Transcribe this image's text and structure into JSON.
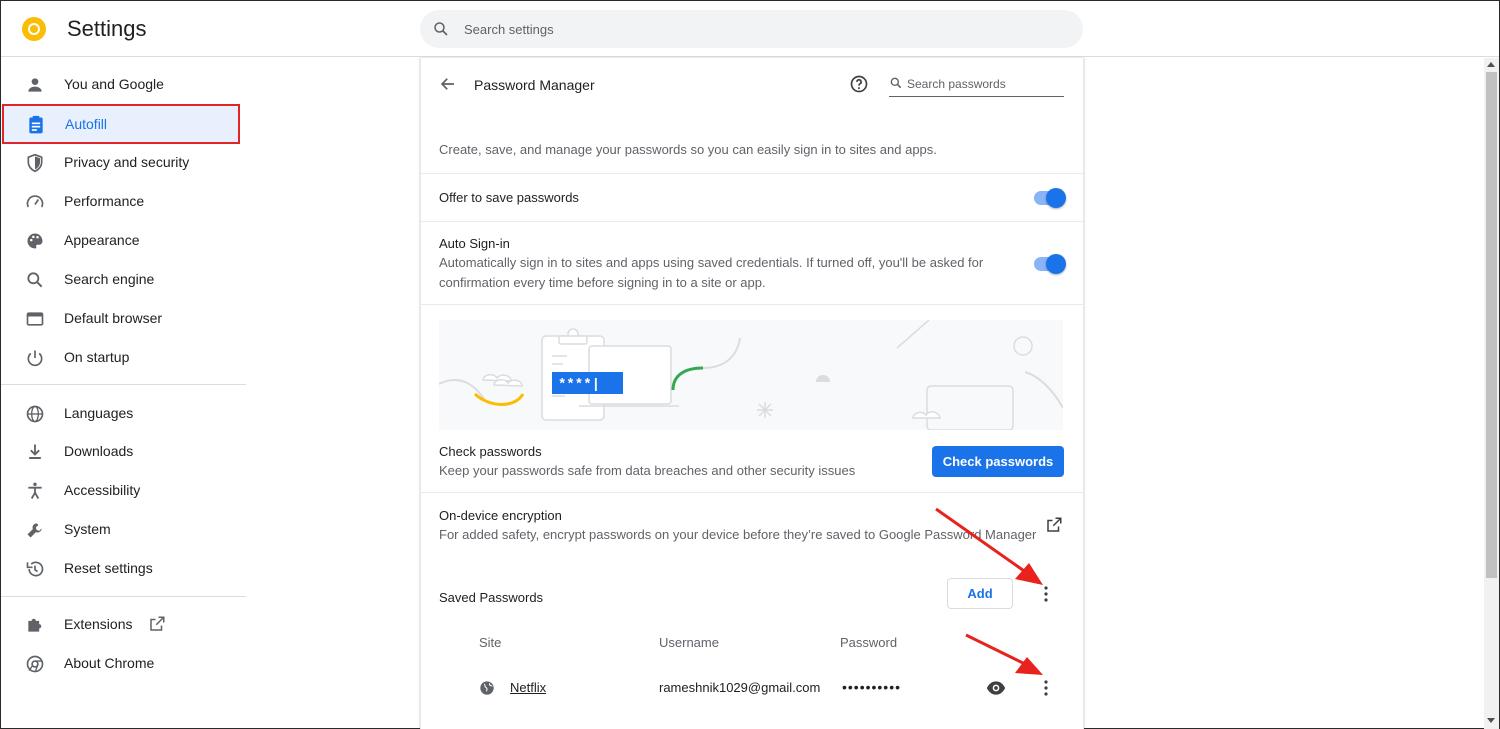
{
  "header": {
    "title": "Settings",
    "search_placeholder": "Search settings"
  },
  "sidebar": {
    "items": [
      {
        "label": "You and Google",
        "icon": "person-icon"
      },
      {
        "label": "Autofill",
        "icon": "clipboard-icon"
      },
      {
        "label": "Privacy and security",
        "icon": "shield-icon"
      },
      {
        "label": "Performance",
        "icon": "speedometer-icon"
      },
      {
        "label": "Appearance",
        "icon": "palette-icon"
      },
      {
        "label": "Search engine",
        "icon": "search-icon"
      },
      {
        "label": "Default browser",
        "icon": "browser-window-icon"
      },
      {
        "label": "On startup",
        "icon": "power-icon"
      },
      {
        "label": "Languages",
        "icon": "globe-icon"
      },
      {
        "label": "Downloads",
        "icon": "download-icon"
      },
      {
        "label": "Accessibility",
        "icon": "accessibility-icon"
      },
      {
        "label": "System",
        "icon": "wrench-icon"
      },
      {
        "label": "Reset settings",
        "icon": "restore-icon"
      },
      {
        "label": "Extensions",
        "icon": "puzzle-icon"
      },
      {
        "label": "About Chrome",
        "icon": "chrome-icon"
      }
    ],
    "active": "Autofill"
  },
  "main": {
    "title": "Password Manager",
    "search_placeholder": "Search passwords",
    "description": "Create, save, and manage your passwords so you can easily sign in to sites and apps.",
    "offer_to_save": {
      "label": "Offer to save passwords",
      "enabled": true
    },
    "auto_signin": {
      "label": "Auto Sign-in",
      "description_line1": "Automatically sign in to sites and apps using saved credentials. If turned off, you'll be asked for",
      "description_line2": "confirmation every time before signing in to a site or app.",
      "enabled": true
    },
    "illustration_password": "****|",
    "check_passwords": {
      "title": "Check passwords",
      "description": "Keep your passwords safe from data breaches and other security issues",
      "button": "Check passwords"
    },
    "encryption": {
      "title": "On-device encryption",
      "description": "For added safety, encrypt passwords on your device before they’re saved to Google Password Manager"
    },
    "saved_passwords": {
      "title": "Saved Passwords",
      "add_button": "Add",
      "columns": [
        "Site",
        "Username",
        "Password"
      ],
      "rows": [
        {
          "site": "Netflix",
          "username": "rameshnik1029@gmail.com",
          "password": "••••••••••"
        }
      ]
    }
  },
  "colors": {
    "accent": "#1a73e8",
    "highlight_border": "#e0242a",
    "annotation_arrow": "#e8221c"
  }
}
